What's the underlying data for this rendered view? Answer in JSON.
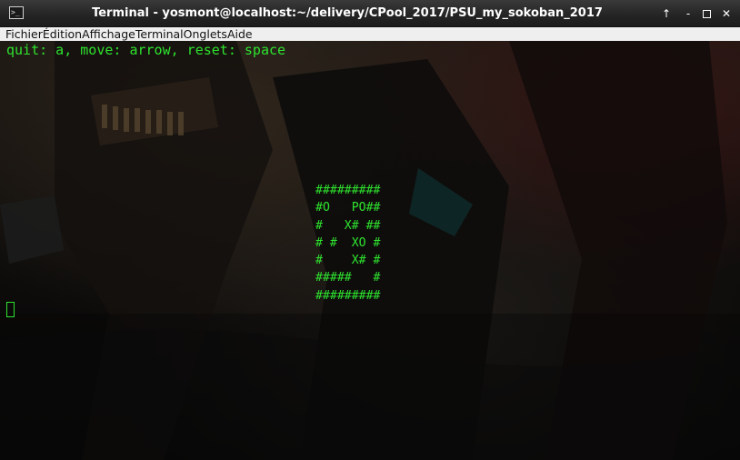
{
  "window": {
    "title": "Terminal - yosmont@localhost:~/delivery/CPool_2017/PSU_my_sokoban_2017",
    "icon": "terminal-icon",
    "buttons": {
      "up": "↑",
      "minimize": "-",
      "close": "✕"
    }
  },
  "menubar": {
    "items": [
      {
        "label": "Fichier"
      },
      {
        "label": "Édition"
      },
      {
        "label": "Affichage"
      },
      {
        "label": "Terminal"
      },
      {
        "label": "Onglets"
      },
      {
        "label": "Aide"
      }
    ]
  },
  "terminal": {
    "text_color": "#2ee22e",
    "help_line": "quit: a, move: arrow, reset: space",
    "map_rows": [
      "#########",
      "#O   PO##",
      "#   X# ##",
      "# #  XO #",
      "#    X# #",
      "#####   #",
      "#########"
    ]
  }
}
